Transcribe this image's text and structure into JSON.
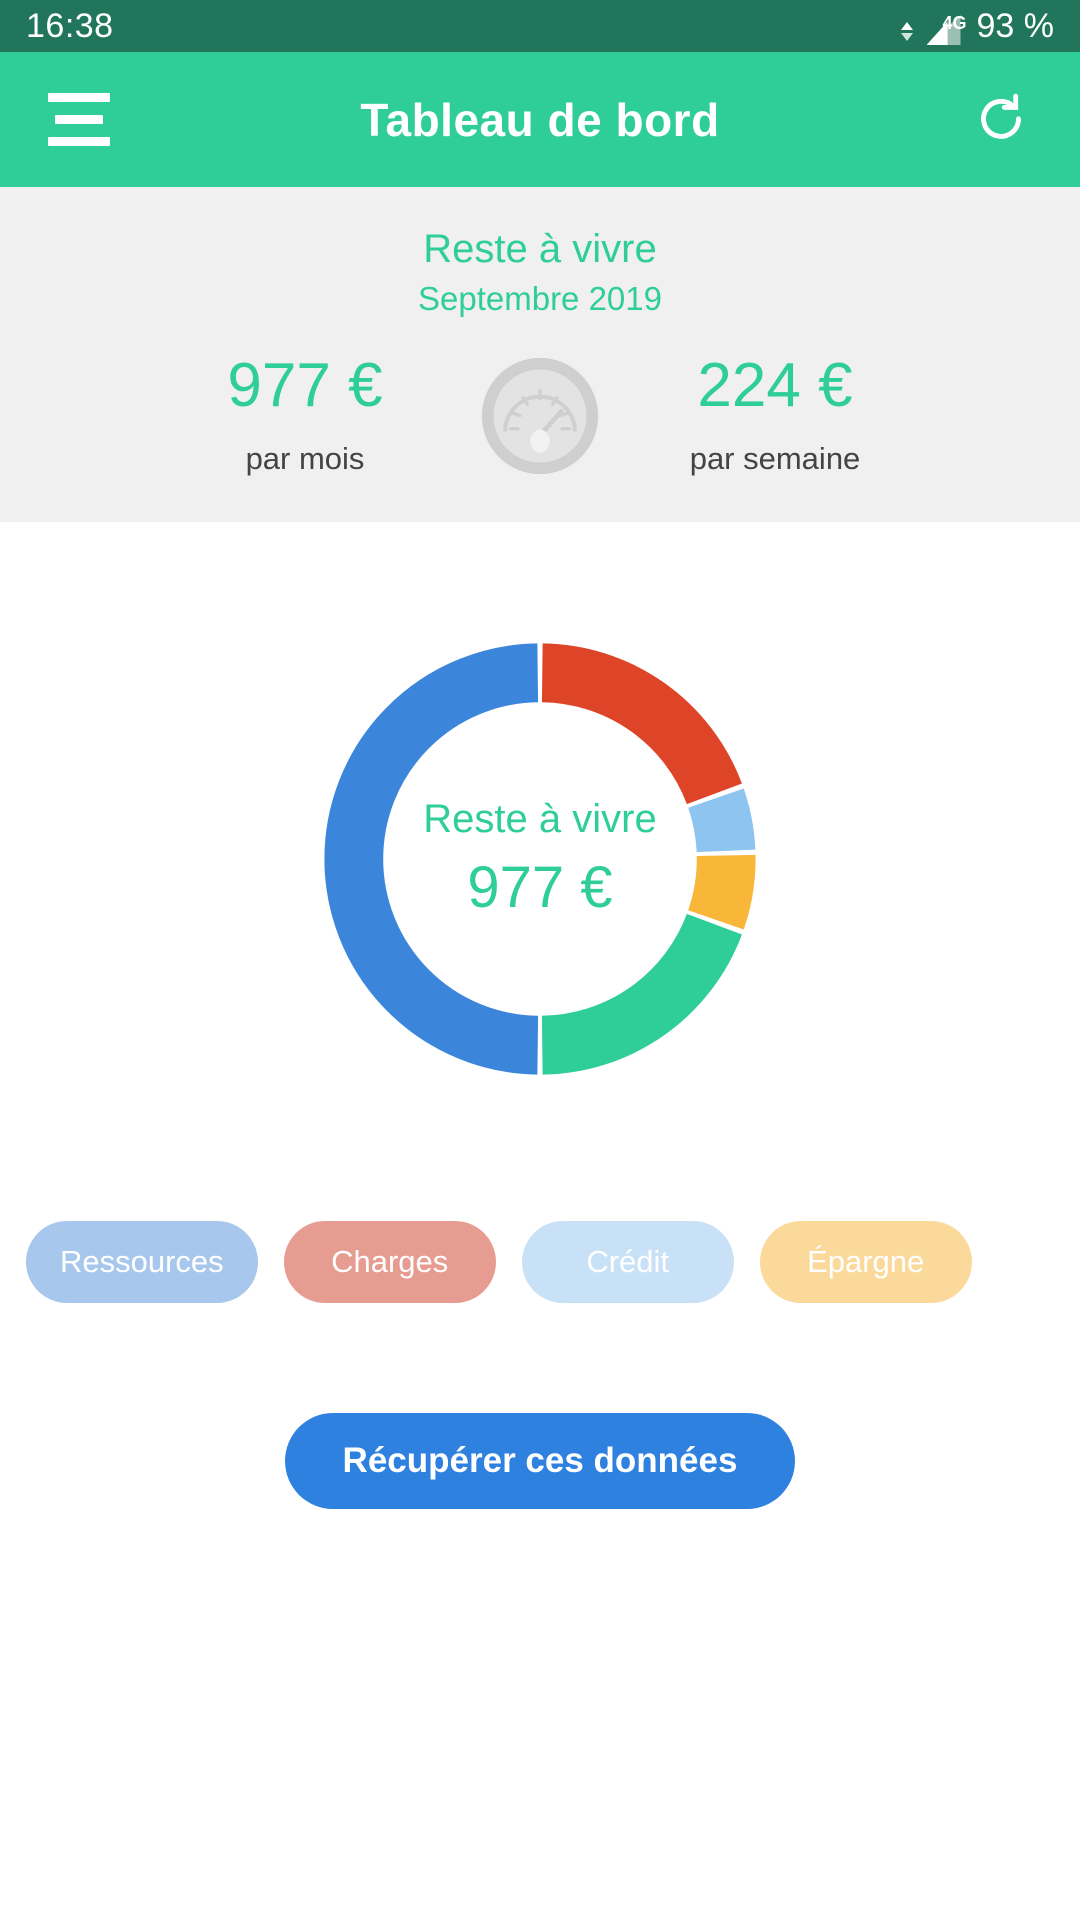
{
  "status_bar": {
    "time": "16:38",
    "network_type": "4G",
    "battery": "93 %",
    "background_color": "#20755B"
  },
  "app_bar": {
    "title": "Tableau de bord",
    "menu_icon": "hamburger-menu-icon",
    "refresh_icon": "refresh-icon",
    "background_color": "#2FCE98"
  },
  "summary": {
    "title": "Reste à vivre",
    "subtitle": "Septembre 2019",
    "gauge_icon": "speedometer-gauge-icon",
    "monthly": {
      "amount": "977 €",
      "label": "par mois"
    },
    "weekly": {
      "amount": "224 €",
      "label": "par semaine"
    },
    "accent_color": "#2FCE98",
    "background_color": "#F0F0F0"
  },
  "chart_data": {
    "type": "pie",
    "title": "Reste à vivre",
    "center_label": "Reste à vivre",
    "center_value": "977 €",
    "donut": true,
    "start_angle": 0,
    "categories": [
      "Ressources",
      "Charges",
      "Crédit",
      "Épargne",
      "Reste à vivre"
    ],
    "values": [
      50,
      19.5,
      5,
      6,
      19.5
    ],
    "unit": "%",
    "colors": [
      "#3B86DB",
      "#DE4528",
      "#8EC5F0",
      "#F8B739",
      "#2FCE98"
    ],
    "series": [
      {
        "name": "Ressources",
        "value": 50,
        "color": "#3B86DB"
      },
      {
        "name": "Charges",
        "value": 19.5,
        "color": "#DE4528"
      },
      {
        "name": "Crédit",
        "value": 5,
        "color": "#8EC5F0"
      },
      {
        "name": "Épargne",
        "value": 6,
        "color": "#F8B739"
      },
      {
        "name": "Reste à vivre",
        "value": 19.5,
        "color": "#2FCE98"
      }
    ],
    "legend_position": "bottom",
    "grid": false,
    "xlabel": "",
    "ylabel": ""
  },
  "chips": [
    {
      "label": "Ressources",
      "color": "#A8C7EC"
    },
    {
      "label": "Charges",
      "color": "#E79C92"
    },
    {
      "label": "Crédit",
      "color": "#C9E1F7"
    },
    {
      "label": "Épargne",
      "color": "#FAD99B"
    }
  ],
  "action_button": {
    "label": "Récupérer ces données",
    "color": "#2F81E0"
  }
}
